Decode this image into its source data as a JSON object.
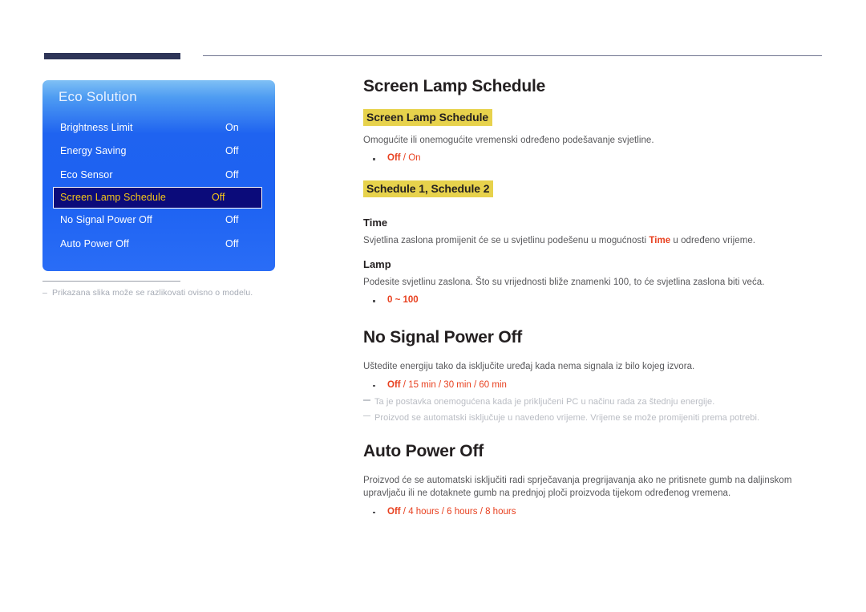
{
  "header": {
    "accent_color": "#2e3558",
    "rule_color": "#6f7490"
  },
  "osd": {
    "title": "Eco Solution",
    "rows": [
      {
        "label": "Brightness Limit",
        "value": "On",
        "selected": false
      },
      {
        "label": "Energy Saving",
        "value": "Off",
        "selected": false
      },
      {
        "label": "Eco Sensor",
        "value": "Off",
        "selected": false
      },
      {
        "label": "Screen Lamp Schedule",
        "value": "Off",
        "selected": true
      },
      {
        "label": "No Signal Power Off",
        "value": "Off",
        "selected": false
      },
      {
        "label": "Auto Power Off",
        "value": "Off",
        "selected": false
      }
    ],
    "caption_dash": "–",
    "caption": "Prikazana slika može se razlikovati ovisno o modelu.",
    "highlight_bg": "#0b0b7a",
    "highlight_text": "#f5c518"
  },
  "content": {
    "section1": {
      "title": "Screen Lamp Schedule",
      "sub1": {
        "heading": "Screen Lamp Schedule",
        "body": "Omogućite ili onemogućite vremenski određeno podešavanje svjetline.",
        "option_bold": "Off",
        "option_rest": " / On"
      },
      "sub2": {
        "heading": "Schedule 1, Schedule 2",
        "time": {
          "heading": "Time",
          "body_a": "Svjetlina zaslona promijenit će se u svjetlinu podešenu u mogućnosti ",
          "body_inline": "Time",
          "body_b": " u određeno vrijeme."
        },
        "lamp": {
          "heading": "Lamp",
          "body": "Podesite svjetlinu zaslona. Što su vrijednosti bliže znamenki 100, to će svjetlina zaslona biti veća.",
          "option": "0 ~ 100"
        }
      }
    },
    "section2": {
      "title": "No Signal Power Off",
      "body": "Uštedite energiju tako da isključite uređaj kada nema signala iz bilo kojeg izvora.",
      "option_bold": "Off",
      "option_rest": " / 15 min / 30 min / 60 min",
      "notes": [
        "Ta je postavka onemogućena kada je priključeni PC u načinu rada za štednju energije.",
        "Proizvod se automatski isključuje u navedeno vrijeme. Vrijeme se može promijeniti prema potrebi."
      ]
    },
    "section3": {
      "title": "Auto Power Off",
      "body": "Proizvod će se automatski isključiti radi sprječavanja pregrijavanja ako ne pritisnete gumb na daljinskom upravljaču ili ne dotaknete gumb na prednjoj ploči proizvoda tijekom određenog vremena.",
      "option_bold": "Off",
      "option_rest": " / 4 hours / 6 hours / 8 hours"
    }
  },
  "colors": {
    "option_red": "#e8401f",
    "highlight_yellow": "#e7d24c",
    "body_gray": "#58585b",
    "note_gray": "#b9bcc3"
  }
}
